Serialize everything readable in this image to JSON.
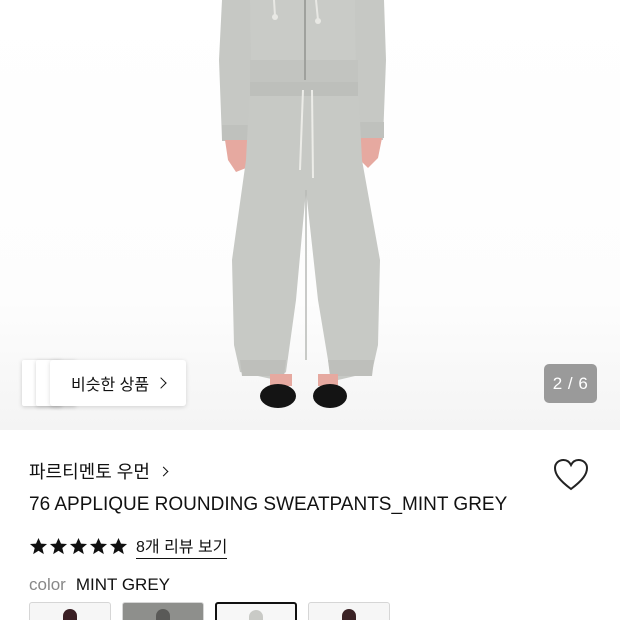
{
  "similar_products": {
    "label": "비슷한 상품"
  },
  "pager": {
    "text": "2 / 6",
    "current": 2,
    "total": 6
  },
  "product": {
    "brand": "파르티멘토 우먼",
    "title": "76 APPLIQUE ROUNDING SWEATPANTS_MINT GREY",
    "rating": 5,
    "reviews_label": "8개 리뷰 보기",
    "color_label": "color",
    "color_value": "MINT GREY"
  },
  "swatches": [
    {
      "fig_color": "#3a1f24",
      "bg": "#f6f6f6",
      "selected": false
    },
    {
      "fig_color": "#5a5a58",
      "bg": "#8e8f8c",
      "selected": false
    },
    {
      "fig_color": "#c9cac6",
      "bg": "#f7f7f7",
      "selected": true
    },
    {
      "fig_color": "#3b2326",
      "bg": "#f6f6f6",
      "selected": false
    }
  ],
  "colors": {
    "text": "#111111",
    "pager_bg": "#9a9a9a",
    "star": "#111111"
  },
  "icons": {
    "heart": "heart-outline-icon",
    "chevron": "chevron-right-icon",
    "star": "star-icon"
  }
}
